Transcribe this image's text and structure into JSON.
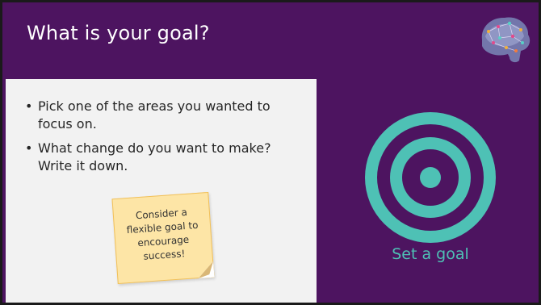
{
  "slide": {
    "title": "What is your goal?",
    "bullets": [
      "Pick one of the areas you wanted to focus on.",
      "What change do you want to make? Write it down."
    ],
    "sticky_note": "Consider a\nflexible goal to\nencourage\nsuccess!",
    "caption": "Set a goal",
    "icons": {
      "logo": "brain-network-icon",
      "target": "target-icon",
      "bullet": "bullet-dot"
    }
  },
  "colors": {
    "background": "#4d1460",
    "panel": "#f2f2f2",
    "accent": "#4ec1b5",
    "sticky": "#fde5a6",
    "text": "#262626"
  }
}
